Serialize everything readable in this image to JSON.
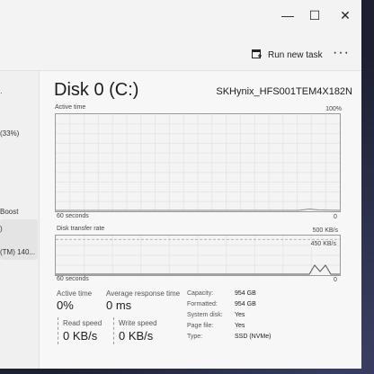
{
  "window": {
    "minimize_glyph": "—",
    "maximize_glyph": "☐",
    "close_glyph": "✕"
  },
  "command_bar": {
    "run_new_task": "Run new task",
    "more_glyph": "···"
  },
  "sidebar": {
    "fragments": [
      "(33%)",
      ")",
      "Boost",
      "(TM) 140..."
    ]
  },
  "disk": {
    "title": "Disk 0 (C:)",
    "model": "SKHynix_HFS001TEM4X182N"
  },
  "active_time_graph": {
    "label": "Active time",
    "max_label": "100%",
    "x_left": "60 seconds",
    "x_right": "0"
  },
  "transfer_graph": {
    "label": "Disk transfer rate",
    "max_label": "500 KB/s",
    "inner_label": "450 KB/s",
    "x_left": "60 seconds",
    "x_right": "0"
  },
  "stats": {
    "active_time_label": "Active time",
    "active_time_value": "0%",
    "response_label": "Average response time",
    "response_value": "0 ms",
    "read_label": "Read speed",
    "read_value": "0 KB/s",
    "write_label": "Write speed",
    "write_value": "0 KB/s"
  },
  "properties": [
    {
      "key": "Capacity:",
      "value": "954 GB"
    },
    {
      "key": "Formatted:",
      "value": "954 GB"
    },
    {
      "key": "System disk:",
      "value": "Yes"
    },
    {
      "key": "Page file:",
      "value": "Yes"
    },
    {
      "key": "Type:",
      "value": "SSD (NVMe)"
    }
  ],
  "colors": {
    "graph_line": "#8a8a8a",
    "graph_grid": "#e6e6e6"
  }
}
